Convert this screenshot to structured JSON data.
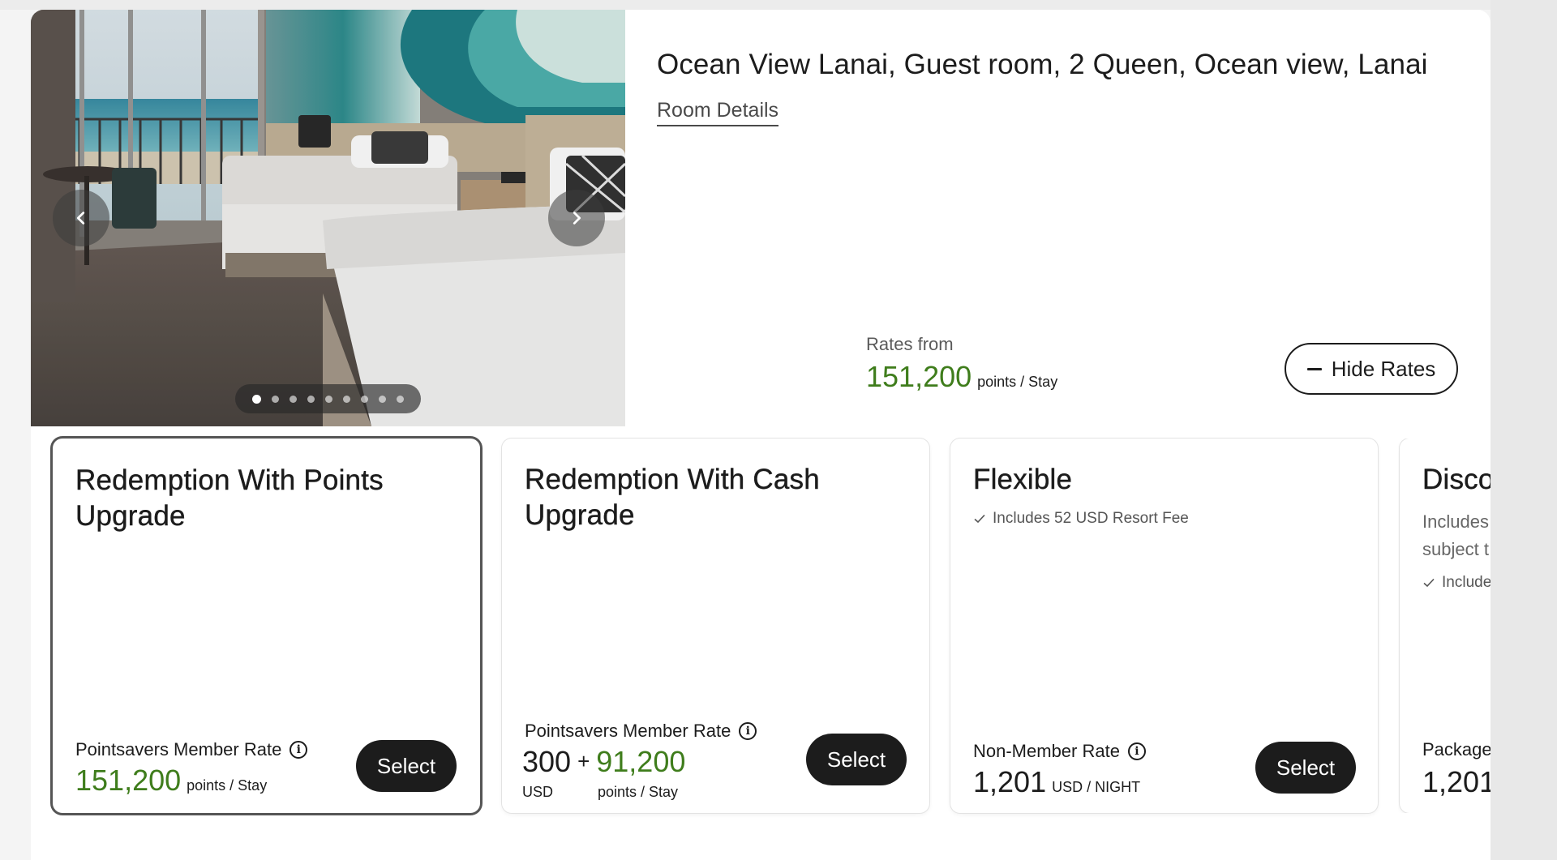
{
  "room": {
    "title": "Ocean View Lanai, Guest room, 2 Queen, Ocean view, Lanai",
    "details_link": "Room Details",
    "rates_from_label": "Rates from",
    "rates_from_value": "151,200",
    "rates_from_unit": "points / Stay",
    "hide_rates_label": "Hide Rates",
    "carousel": {
      "slide_count": 9,
      "active_index": 0
    }
  },
  "rates": [
    {
      "title": "Redemption With Points Upgrade",
      "rate_label": "Pointsavers Member Rate",
      "price": "151,200",
      "price_unit": "points / Stay",
      "select_label": "Select",
      "selected": true
    },
    {
      "title": "Redemption With Cash Upgrade",
      "rate_label": "Pointsavers Member Rate",
      "cash_amount": "300",
      "plus": "+",
      "points_amount": "91,200",
      "cash_unit": "USD",
      "points_unit": "points / Stay",
      "select_label": "Select"
    },
    {
      "title": "Flexible",
      "note": "Includes 52 USD Resort Fee",
      "rate_label": "Non-Member Rate",
      "price": "1,201",
      "price_unit": "USD / NIGHT",
      "select_label": "Select"
    },
    {
      "title": "Disco",
      "desc_line1": "Includes",
      "desc_line2": "subject t",
      "note": "Include",
      "rate_label": "Package",
      "price": "1,201"
    }
  ],
  "colors": {
    "points_green": "#3f7d1c",
    "button_dark": "#1c1c1c"
  },
  "icons": [
    "chevron-left-icon",
    "chevron-right-icon",
    "minus-icon",
    "info-icon",
    "check-icon"
  ]
}
